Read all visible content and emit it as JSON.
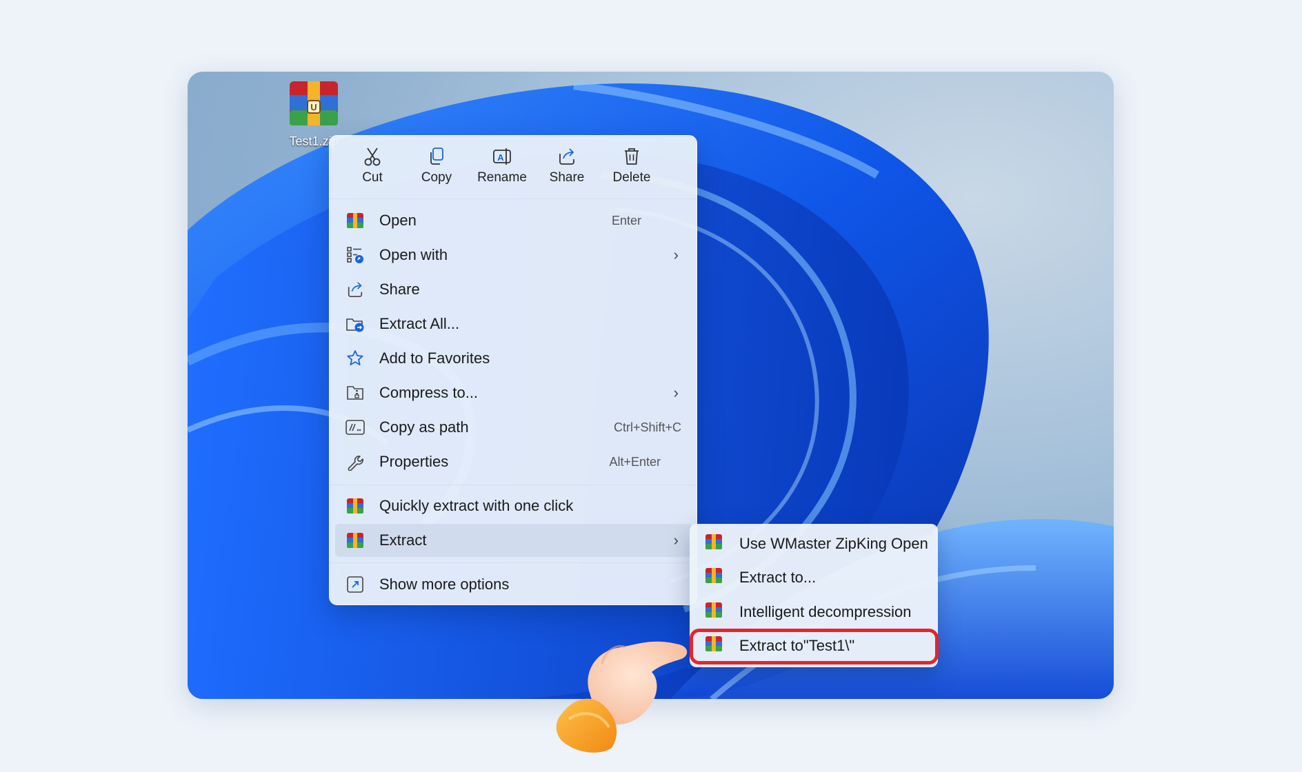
{
  "desktop_icon": {
    "label": "Test1.zip",
    "icon": "winrar-archive-icon"
  },
  "quick_actions": [
    {
      "label": "Cut",
      "icon": "scissors-icon"
    },
    {
      "label": "Copy",
      "icon": "copy-icon"
    },
    {
      "label": "Rename",
      "icon": "rename-icon"
    },
    {
      "label": "Share",
      "icon": "share-icon"
    },
    {
      "label": "Delete",
      "icon": "trash-icon"
    }
  ],
  "menu_items": [
    {
      "label": "Open",
      "shortcut": "Enter",
      "icon": "archive-icon"
    },
    {
      "label": "Open with",
      "submenu": true,
      "icon": "open-with-icon"
    },
    {
      "label": "Share",
      "icon": "share-icon"
    },
    {
      "label": "Extract All...",
      "icon": "extract-folder-icon"
    },
    {
      "label": "Add to Favorites",
      "icon": "star-icon"
    },
    {
      "label": "Compress to...",
      "submenu": true,
      "icon": "zip-folder-icon"
    },
    {
      "label": "Copy as path",
      "shortcut": "Ctrl+Shift+C",
      "icon": "path-icon"
    },
    {
      "label": "Properties",
      "shortcut": "Alt+Enter",
      "icon": "wrench-icon"
    },
    {
      "label": "Quickly extract with one click",
      "icon": "archive-icon"
    },
    {
      "label": "Extract",
      "submenu": true,
      "icon": "archive-icon"
    },
    {
      "label": "Show more options",
      "icon": "more-options-icon"
    }
  ],
  "extract_submenu": [
    {
      "label": "Use WMaster ZipKing Open",
      "icon": "archive-icon"
    },
    {
      "label": "Extract to...",
      "icon": "archive-icon"
    },
    {
      "label": "Intelligent decompression",
      "icon": "archive-icon"
    },
    {
      "label": "Extract to\"Test1\\\"",
      "icon": "archive-icon"
    }
  ],
  "colors": {
    "highlight": "#e3262b",
    "accent": "#1565e0"
  }
}
